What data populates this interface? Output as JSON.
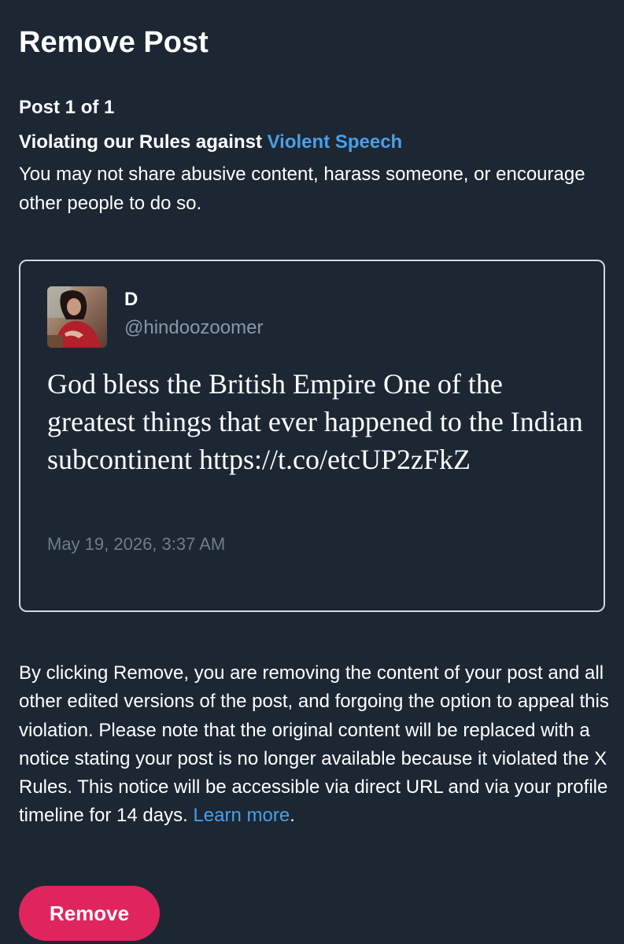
{
  "page": {
    "title": "Remove Post",
    "post_count": "Post 1 of 1"
  },
  "violation": {
    "heading_prefix": "Violating our Rules against ",
    "rule_name": "Violent Speech",
    "description": "You may not share abusive content, harass someone, or encourage other people to do so."
  },
  "post": {
    "display_name": "D",
    "handle": "@hindoozoomer",
    "text": "God bless the British Empire One of the greatest things that ever happened to the Indian subcontinent",
    "link": "https://t.co/etcUP2zFkZ",
    "timestamp": "May 19, 2026, 3:37 AM",
    "avatar_icon": "profile-photo"
  },
  "notice": {
    "text": "By clicking Remove, you are removing the content of your post and all other edited versions of the post, and forgoing the option to appeal this violation. Please note that the original content will be replaced with a notice stating your post is no longer available because it violated the X Rules. This notice will be accessible via direct URL and via your profile timeline for 14 days. ",
    "learn_more": "Learn more",
    "period": "."
  },
  "actions": {
    "remove_label": "Remove"
  },
  "colors": {
    "background": "#1c2733",
    "link": "#4a9fe8",
    "remove_button": "#e0245e",
    "secondary_text": "#8899a6",
    "card_border": "#d3d8de"
  }
}
